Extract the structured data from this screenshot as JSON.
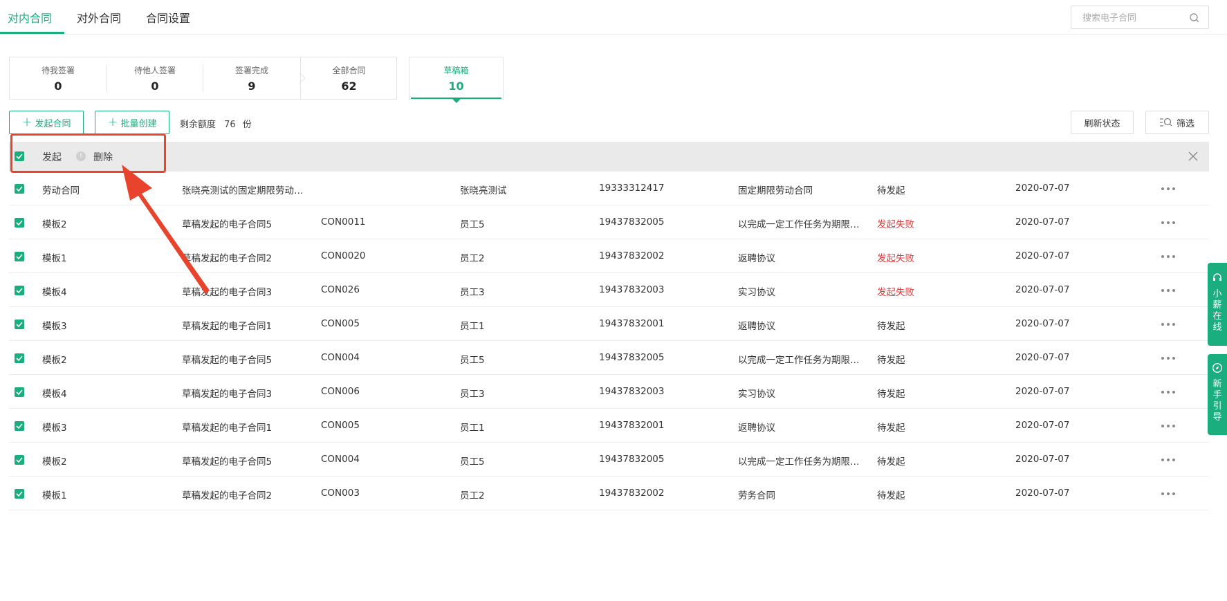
{
  "tabs": [
    "对内合同",
    "对外合同",
    "合同设置"
  ],
  "search": {
    "placeholder": "搜索电子合同"
  },
  "stats": [
    {
      "label": "待我签署",
      "value": "0"
    },
    {
      "label": "待他人签署",
      "value": "0"
    },
    {
      "label": "签署完成",
      "value": "9"
    },
    {
      "label": "全部合同",
      "value": "62"
    }
  ],
  "draft": {
    "label": "草稿箱",
    "value": "10"
  },
  "toolbar": {
    "start_label": "发起合同",
    "batch_label": "批量创建",
    "quota_label": "剩余额度",
    "quota_value": "76",
    "quota_unit": "份",
    "refresh_label": "刷新状态",
    "filter_label": "筛选"
  },
  "selection": {
    "start_label": "发起",
    "delete_label": "删除"
  },
  "rows": [
    {
      "template": "劳动合同",
      "name": "张晓亮测试的固定期限劳动…",
      "code": "",
      "employee": "张晓亮测试",
      "phone": "19333312417",
      "type": "固定期限劳动合同",
      "status": "待发起",
      "date": "2020-07-07"
    },
    {
      "template": "模板2",
      "name": "草稿发起的电子合同5",
      "code": "CON0011",
      "employee": "员工5",
      "phone": "19437832005",
      "type": "以完成一定工作任务为期限…",
      "status": "发起失败",
      "date": "2020-07-07"
    },
    {
      "template": "模板1",
      "name": "草稿发起的电子合同2",
      "code": "CON0020",
      "employee": "员工2",
      "phone": "19437832002",
      "type": "返聘协议",
      "status": "发起失败",
      "date": "2020-07-07"
    },
    {
      "template": "模板4",
      "name": "草稿发起的电子合同3",
      "code": "CON026",
      "employee": "员工3",
      "phone": "19437832003",
      "type": "实习协议",
      "status": "发起失败",
      "date": "2020-07-07"
    },
    {
      "template": "模板3",
      "name": "草稿发起的电子合同1",
      "code": "CON005",
      "employee": "员工1",
      "phone": "19437832001",
      "type": "返聘协议",
      "status": "待发起",
      "date": "2020-07-07"
    },
    {
      "template": "模板2",
      "name": "草稿发起的电子合同5",
      "code": "CON004",
      "employee": "员工5",
      "phone": "19437832005",
      "type": "以完成一定工作任务为期限…",
      "status": "待发起",
      "date": "2020-07-07"
    },
    {
      "template": "模板4",
      "name": "草稿发起的电子合同3",
      "code": "CON006",
      "employee": "员工3",
      "phone": "19437832003",
      "type": "实习协议",
      "status": "待发起",
      "date": "2020-07-07"
    },
    {
      "template": "模板3",
      "name": "草稿发起的电子合同1",
      "code": "CON005",
      "employee": "员工1",
      "phone": "19437832001",
      "type": "返聘协议",
      "status": "待发起",
      "date": "2020-07-07"
    },
    {
      "template": "模板2",
      "name": "草稿发起的电子合同5",
      "code": "CON004",
      "employee": "员工5",
      "phone": "19437832005",
      "type": "以完成一定工作任务为期限…",
      "status": "待发起",
      "date": "2020-07-07"
    },
    {
      "template": "模板1",
      "name": "草稿发起的电子合同2",
      "code": "CON003",
      "employee": "员工2",
      "phone": "19437832002",
      "type": "劳务合同",
      "status": "待发起",
      "date": "2020-07-07"
    }
  ],
  "side_widgets": [
    {
      "label": "小薪在线",
      "icon": "headset-icon"
    },
    {
      "label": "新手引导",
      "icon": "compass-icon"
    }
  ],
  "colors": {
    "accent": "#1aad7e",
    "fail": "#e23a3a",
    "annotation": "#e8432c"
  }
}
